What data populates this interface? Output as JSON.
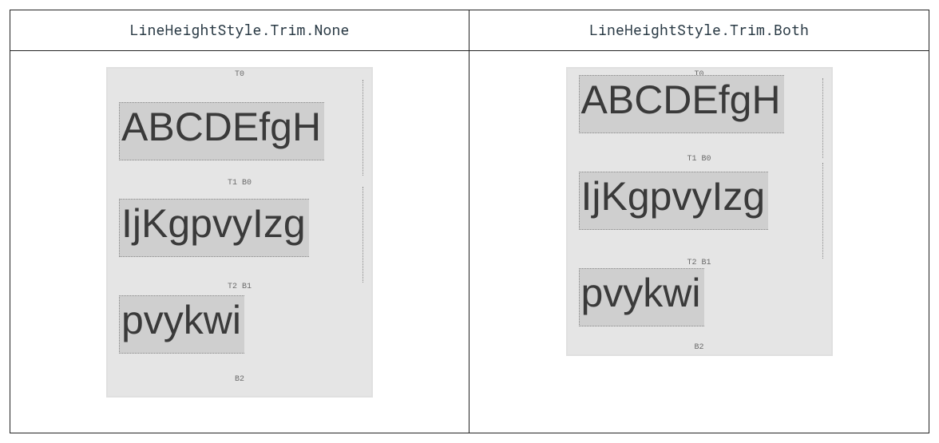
{
  "table": {
    "header_left": "LineHeightStyle.Trim.None",
    "header_right": "LineHeightStyle.Trim.Both",
    "sample_line_1": "ABCDEfgH",
    "sample_line_2": "IjKgpvyIzg",
    "sample_line_3": "pvykwi",
    "ruler": {
      "t0": "T0",
      "t1b0": "T1   B0",
      "t2b1": "T2   B1",
      "b2": "B2"
    }
  }
}
